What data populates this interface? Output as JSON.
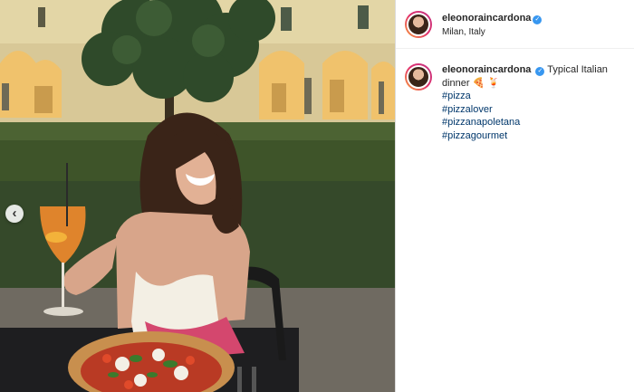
{
  "post": {
    "username": "eleonoraincardona",
    "location": "Milan, Italy",
    "caption": "Typical Italian dinner",
    "caption_emojis": "🍕 🍹",
    "hashtags": [
      "#pizza",
      "#pizzalover",
      "#pizzanapoletana",
      "#pizzagourmet"
    ],
    "verified_glyph": "✓"
  },
  "photo": {
    "alt": "Woman holding a spritz cocktail beside a pizza in a courtyard",
    "prev_glyph": "‹"
  }
}
